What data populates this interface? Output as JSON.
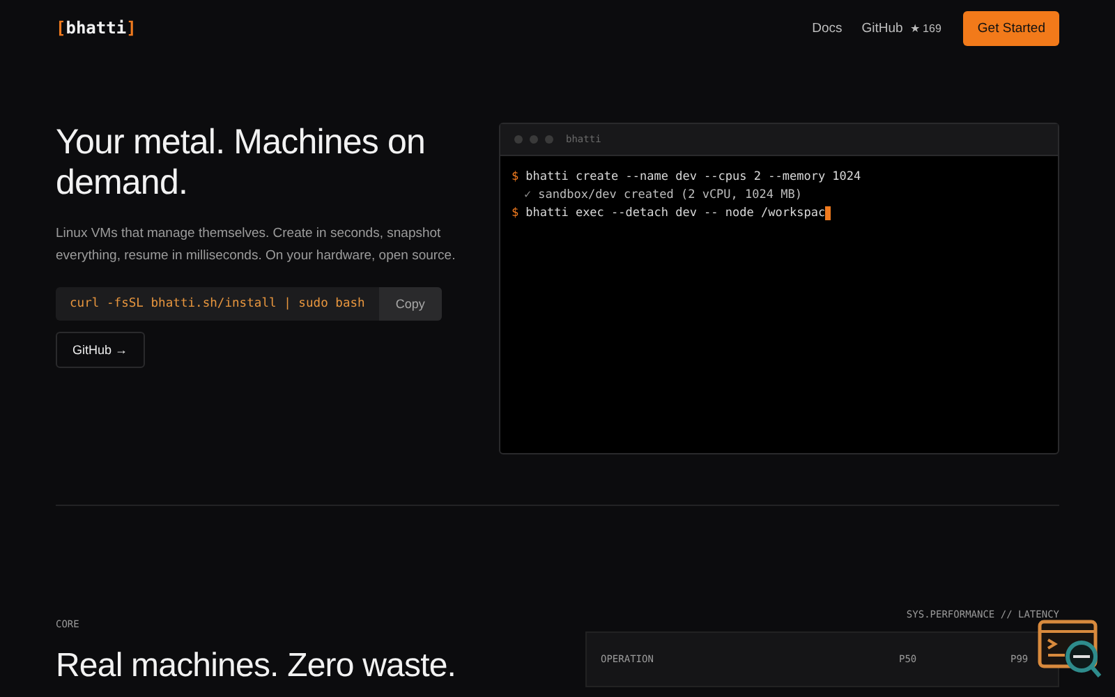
{
  "header": {
    "logo_open": "[",
    "logo_name": "bhatti",
    "logo_close": "]",
    "nav": [
      {
        "label": "Docs"
      },
      {
        "label": "GitHub",
        "stars": "★ 169"
      }
    ],
    "cta": "Get Started"
  },
  "hero": {
    "title": "Your metal. Machines on demand.",
    "description": "Linux VMs that manage themselves. Create in seconds, snapshot everything, resume in milliseconds. On your hardware, open source.",
    "install_command": "curl -fsSL bhatti.sh/install | sudo bash",
    "copy_button": "Copy",
    "github_button": "GitHub →"
  },
  "terminal": {
    "title": "bhatti",
    "lines": [
      {
        "kind": "command",
        "prompt": "$",
        "text": "bhatti create --name dev --cpus 2 --memory 1024"
      },
      {
        "kind": "output",
        "prompt": "✓",
        "text": "sandbox/dev created (2 vCPU, 1024 MB)"
      },
      {
        "kind": "command",
        "prompt": "$",
        "text": "bhatti exec --detach dev -- node /workspac",
        "cursor": true
      }
    ]
  },
  "section": {
    "eyebrow": "CORE",
    "title": "Real machines. Zero waste.",
    "table_caption": "SYS.PERFORMANCE // LATENCY",
    "columns": [
      "OPERATION",
      "P50",
      "P99"
    ]
  }
}
